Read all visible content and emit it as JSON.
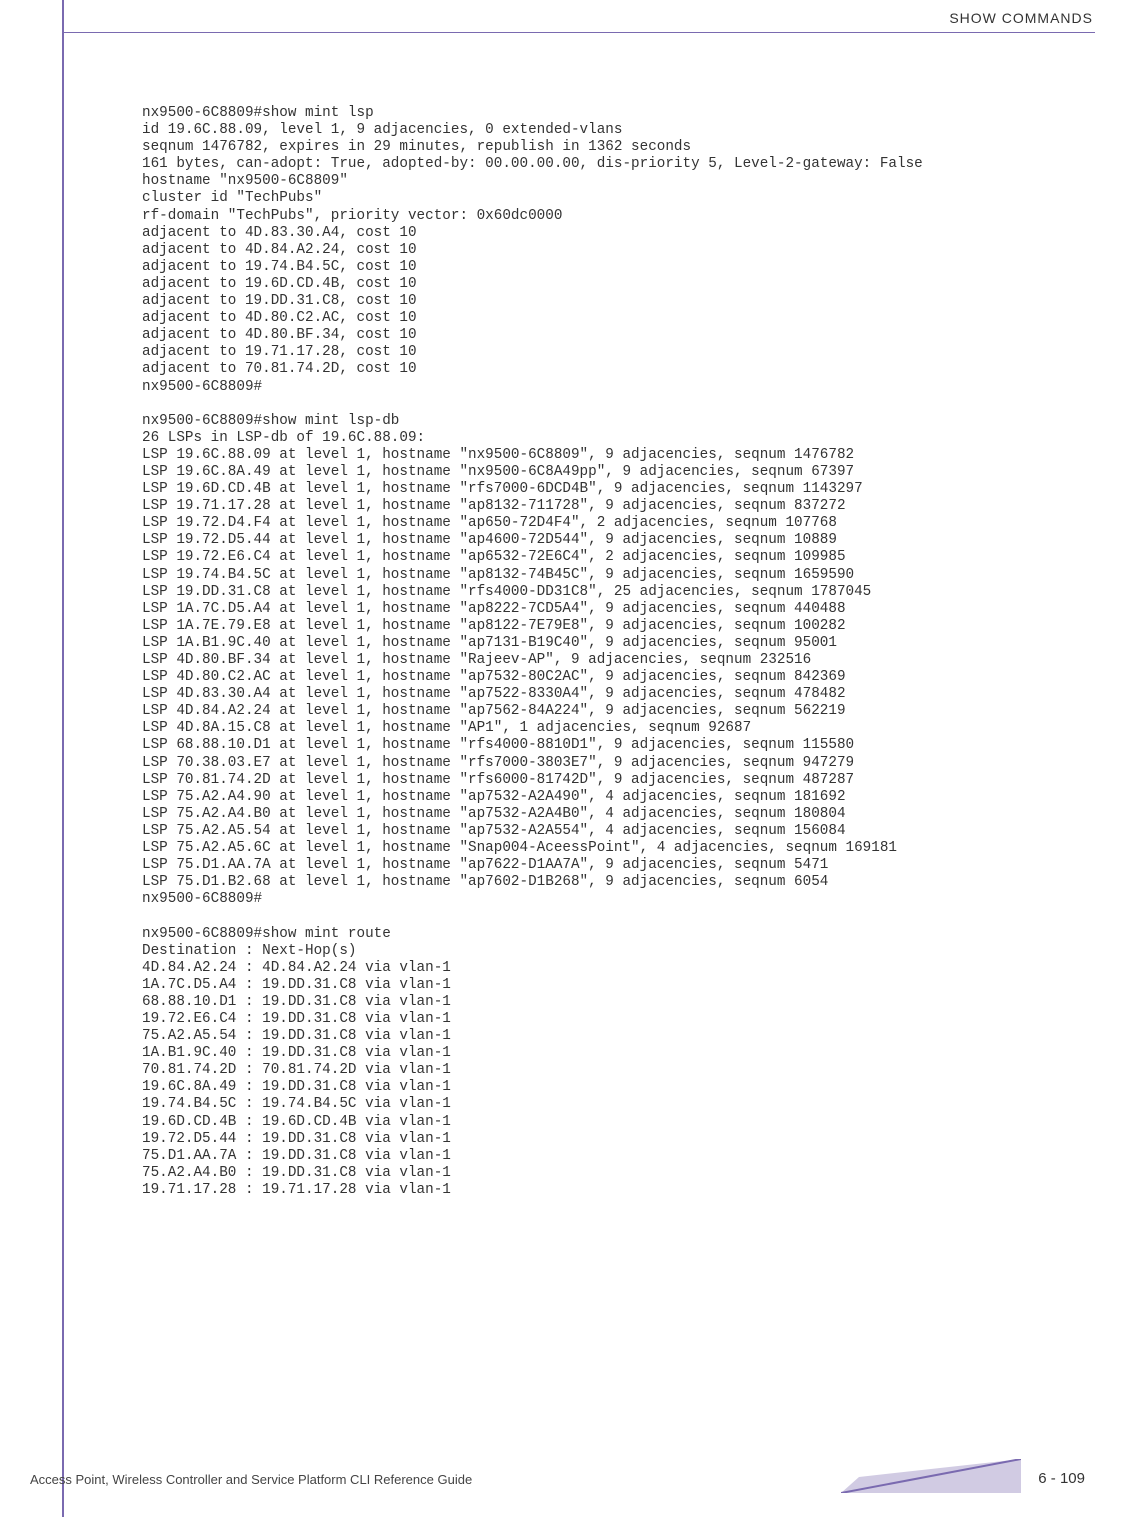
{
  "header": {
    "title": "SHOW COMMANDS"
  },
  "terminal": {
    "blocks": [
      "nx9500-6C8809#show mint lsp\nid 19.6C.88.09, level 1, 9 adjacencies, 0 extended-vlans\nseqnum 1476782, expires in 29 minutes, republish in 1362 seconds\n161 bytes, can-adopt: True, adopted-by: 00.00.00.00, dis-priority 5, Level-2-gateway: False\nhostname \"nx9500-6C8809\"\ncluster id \"TechPubs\"\nrf-domain \"TechPubs\", priority vector: 0x60dc0000\nadjacent to 4D.83.30.A4, cost 10\nadjacent to 4D.84.A2.24, cost 10\nadjacent to 19.74.B4.5C, cost 10\nadjacent to 19.6D.CD.4B, cost 10\nadjacent to 19.DD.31.C8, cost 10\nadjacent to 4D.80.C2.AC, cost 10\nadjacent to 4D.80.BF.34, cost 10\nadjacent to 19.71.17.28, cost 10\nadjacent to 70.81.74.2D, cost 10\nnx9500-6C8809#",
      "nx9500-6C8809#show mint lsp-db\n26 LSPs in LSP-db of 19.6C.88.09:\nLSP 19.6C.88.09 at level 1, hostname \"nx9500-6C8809\", 9 adjacencies, seqnum 1476782\nLSP 19.6C.8A.49 at level 1, hostname \"nx9500-6C8A49pp\", 9 adjacencies, seqnum 67397\nLSP 19.6D.CD.4B at level 1, hostname \"rfs7000-6DCD4B\", 9 adjacencies, seqnum 1143297\nLSP 19.71.17.28 at level 1, hostname \"ap8132-711728\", 9 adjacencies, seqnum 837272\nLSP 19.72.D4.F4 at level 1, hostname \"ap650-72D4F4\", 2 adjacencies, seqnum 107768\nLSP 19.72.D5.44 at level 1, hostname \"ap4600-72D544\", 9 adjacencies, seqnum 10889\nLSP 19.72.E6.C4 at level 1, hostname \"ap6532-72E6C4\", 2 adjacencies, seqnum 109985\nLSP 19.74.B4.5C at level 1, hostname \"ap8132-74B45C\", 9 adjacencies, seqnum 1659590\nLSP 19.DD.31.C8 at level 1, hostname \"rfs4000-DD31C8\", 25 adjacencies, seqnum 1787045\nLSP 1A.7C.D5.A4 at level 1, hostname \"ap8222-7CD5A4\", 9 adjacencies, seqnum 440488\nLSP 1A.7E.79.E8 at level 1, hostname \"ap8122-7E79E8\", 9 adjacencies, seqnum 100282\nLSP 1A.B1.9C.40 at level 1, hostname \"ap7131-B19C40\", 9 adjacencies, seqnum 95001\nLSP 4D.80.BF.34 at level 1, hostname \"Rajeev-AP\", 9 adjacencies, seqnum 232516\nLSP 4D.80.C2.AC at level 1, hostname \"ap7532-80C2AC\", 9 adjacencies, seqnum 842369\nLSP 4D.83.30.A4 at level 1, hostname \"ap7522-8330A4\", 9 adjacencies, seqnum 478482\nLSP 4D.84.A2.24 at level 1, hostname \"ap7562-84A224\", 9 adjacencies, seqnum 562219\nLSP 4D.8A.15.C8 at level 1, hostname \"AP1\", 1 adjacencies, seqnum 92687\nLSP 68.88.10.D1 at level 1, hostname \"rfs4000-8810D1\", 9 adjacencies, seqnum 115580\nLSP 70.38.03.E7 at level 1, hostname \"rfs7000-3803E7\", 9 adjacencies, seqnum 947279\nLSP 70.81.74.2D at level 1, hostname \"rfs6000-81742D\", 9 adjacencies, seqnum 487287\nLSP 75.A2.A4.90 at level 1, hostname \"ap7532-A2A490\", 4 adjacencies, seqnum 181692\nLSP 75.A2.A4.B0 at level 1, hostname \"ap7532-A2A4B0\", 4 adjacencies, seqnum 180804\nLSP 75.A2.A5.54 at level 1, hostname \"ap7532-A2A554\", 4 adjacencies, seqnum 156084\nLSP 75.A2.A5.6C at level 1, hostname \"Snap004-AceessPoint\", 4 adjacencies, seqnum 169181\nLSP 75.D1.AA.7A at level 1, hostname \"ap7622-D1AA7A\", 9 adjacencies, seqnum 5471\nLSP 75.D1.B2.68 at level 1, hostname \"ap7602-D1B268\", 9 adjacencies, seqnum 6054\nnx9500-6C8809#",
      "nx9500-6C8809#show mint route\nDestination : Next-Hop(s)\n4D.84.A2.24 : 4D.84.A2.24 via vlan-1\n1A.7C.D5.A4 : 19.DD.31.C8 via vlan-1\n68.88.10.D1 : 19.DD.31.C8 via vlan-1\n19.72.E6.C4 : 19.DD.31.C8 via vlan-1\n75.A2.A5.54 : 19.DD.31.C8 via vlan-1\n1A.B1.9C.40 : 19.DD.31.C8 via vlan-1\n70.81.74.2D : 70.81.74.2D via vlan-1\n19.6C.8A.49 : 19.DD.31.C8 via vlan-1\n19.74.B4.5C : 19.74.B4.5C via vlan-1\n19.6D.CD.4B : 19.6D.CD.4B via vlan-1\n19.72.D5.44 : 19.DD.31.C8 via vlan-1\n75.D1.AA.7A : 19.DD.31.C8 via vlan-1\n75.A2.A4.B0 : 19.DD.31.C8 via vlan-1\n19.71.17.28 : 19.71.17.28 via vlan-1"
    ]
  },
  "footer": {
    "guide_title": "Access Point, Wireless Controller and Service Platform CLI Reference Guide",
    "page_number": "6 - 109"
  }
}
